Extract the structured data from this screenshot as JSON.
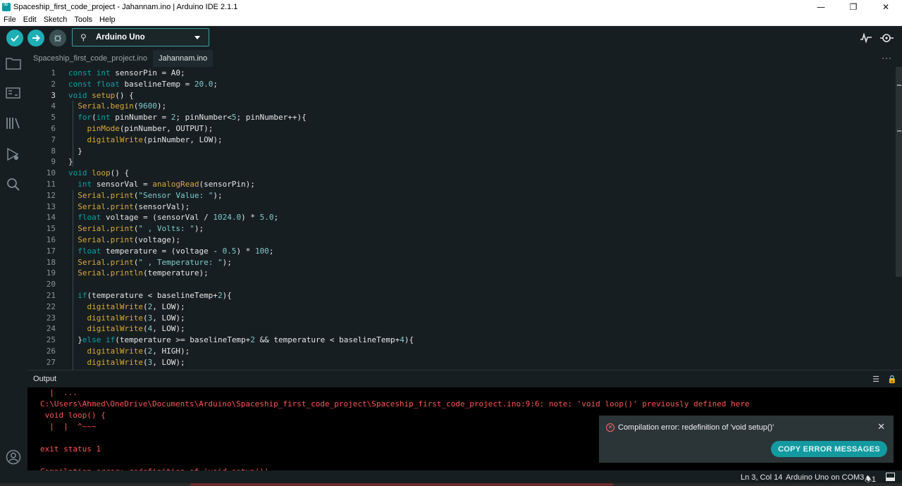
{
  "window": {
    "title": "Spaceship_first_code_project - Jahannam.ino | Arduino IDE 2.1.1",
    "minimize": "—",
    "maximize": "❐",
    "close": "✕"
  },
  "menu": [
    "File",
    "Edit",
    "Sketch",
    "Tools",
    "Help"
  ],
  "toolbar": {
    "board": "Arduino Uno"
  },
  "tabs": [
    {
      "label": "Spaceship_first_code_project.ino",
      "active": false
    },
    {
      "label": "Jahannam.ino",
      "active": true
    }
  ],
  "tab_more": "···",
  "editor": {
    "current_line": 3,
    "line_numbers": [
      "1",
      "2",
      "3",
      "4",
      "5",
      "6",
      "7",
      "8",
      "9",
      "10",
      "11",
      "12",
      "13",
      "14",
      "15",
      "16",
      "17",
      "18",
      "19",
      "20",
      "21",
      "22",
      "23",
      "24",
      "25",
      "26",
      "27"
    ],
    "lines": [
      "const int sensorPin = A0;",
      "const float baselineTemp = 20.0;",
      "void setup() {",
      "  Serial.begin(9600);",
      "  for(int pinNumber = 2; pinNumber<5; pinNumber++){",
      "    pinMode(pinNumber, OUTPUT);",
      "    digitalWrite(pinNumber, LOW);",
      "  }",
      "}",
      "void loop() {",
      "  int sensorVal = analogRead(sensorPin);",
      "  Serial.print(\"Sensor Value: \");",
      "  Serial.print(sensorVal);",
      "  float voltage = (sensorVal / 1024.0) * 5.0;",
      "  Serial.print(\" , Volts: \");",
      "  Serial.print(voltage);",
      "  float temperature = (voltage - 0.5) * 100;",
      "  Serial.print(\" , Temperature: \");",
      "  Serial.println(temperature);",
      "",
      "  if(temperature < baselineTemp+2){",
      "    digitalWrite(2, LOW);",
      "    digitalWrite(3, LOW);",
      "    digitalWrite(4, LOW);",
      "  }else if(temperature >= baselineTemp+2 && temperature < baselineTemp+4){",
      "    digitalWrite(2, HIGH);",
      "    digitalWrite(3, LOW);"
    ]
  },
  "output": {
    "title": "Output",
    "lines": [
      "  |  ...",
      "C:\\Users\\Ahmed\\OneDrive\\Documents\\Arduino\\Spaceship_first_code_project\\Spaceship_first_code_project.ino:9:6: note: 'void loop()' previously defined here",
      " void loop() {",
      "  |  |  ^~~~",
      "",
      "exit status 1",
      "",
      "Compilation error: redefinition of 'void setup()'"
    ]
  },
  "notification": {
    "message": "Compilation error: redefinition of 'void setup()'",
    "close": "✕",
    "button": "COPY ERROR MESSAGES"
  },
  "status": {
    "position": "Ln 3, Col 14",
    "board_port": "Arduino Uno on COM3",
    "notifications": "1"
  },
  "colors": {
    "keyword": "#0ca1a6",
    "function": "#d9a93a",
    "number": "#7fcbcd",
    "string": "#7fcbcd",
    "error_text": "#ff5656",
    "accent": "#1dafb5"
  }
}
